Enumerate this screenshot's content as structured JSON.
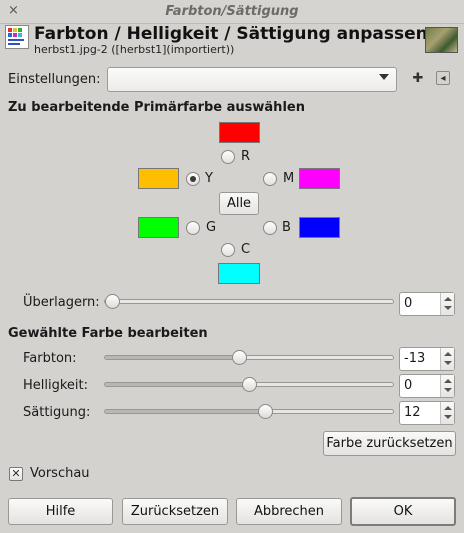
{
  "window": {
    "title": "Farbton/Sättigung",
    "close_glyph": "×"
  },
  "header": {
    "title": "Farbton / Helligkeit / Sättigung anpassen",
    "subtitle": "herbst1.jpg-2 ([herbst1](importiert))",
    "icon": "hue-saturation-tool-icon",
    "thumbnail": "image-thumbnail"
  },
  "settings": {
    "label": "Einstellungen:",
    "value": "",
    "add_icon": "plus-icon",
    "menu_icon": "left-arrow-icon",
    "add_glyph": "✚",
    "menu_glyph": "◂"
  },
  "primary": {
    "heading": "Zu bearbeitende Primärfarbe auswählen",
    "colors": [
      {
        "key": "R",
        "label": "R",
        "swatch": "#ff0000",
        "selected": false
      },
      {
        "key": "Y",
        "label": "Y",
        "swatch": "#ffbf00",
        "selected": true
      },
      {
        "key": "G",
        "label": "G",
        "swatch": "#00ff00",
        "selected": false
      },
      {
        "key": "C",
        "label": "C",
        "swatch": "#00ffff",
        "selected": false
      },
      {
        "key": "B",
        "label": "B",
        "swatch": "#0000ff",
        "selected": false
      },
      {
        "key": "M",
        "label": "M",
        "swatch": "#ff00ff",
        "selected": false
      }
    ],
    "all_button": "Alle",
    "overlap": {
      "label": "Überlagern:",
      "value": "0",
      "min": 0,
      "max": 100
    }
  },
  "edit": {
    "heading": "Gewählte Farbe bearbeiten",
    "hue": {
      "label": "Farbton:",
      "value": "-13",
      "min": -180,
      "max": 180
    },
    "lightness": {
      "label": "Helligkeit:",
      "value": "0",
      "min": -100,
      "max": 100
    },
    "saturation": {
      "label": "Sättigung:",
      "value": "12",
      "min": -100,
      "max": 100
    },
    "reset_color_button": "Farbe zurücksetzen"
  },
  "preview": {
    "label": "Vorschau",
    "checked": true,
    "check_glyph": "✕"
  },
  "buttons": {
    "help": "Hilfe",
    "reset": "Zurücksetzen",
    "cancel": "Abbrechen",
    "ok": "OK"
  }
}
